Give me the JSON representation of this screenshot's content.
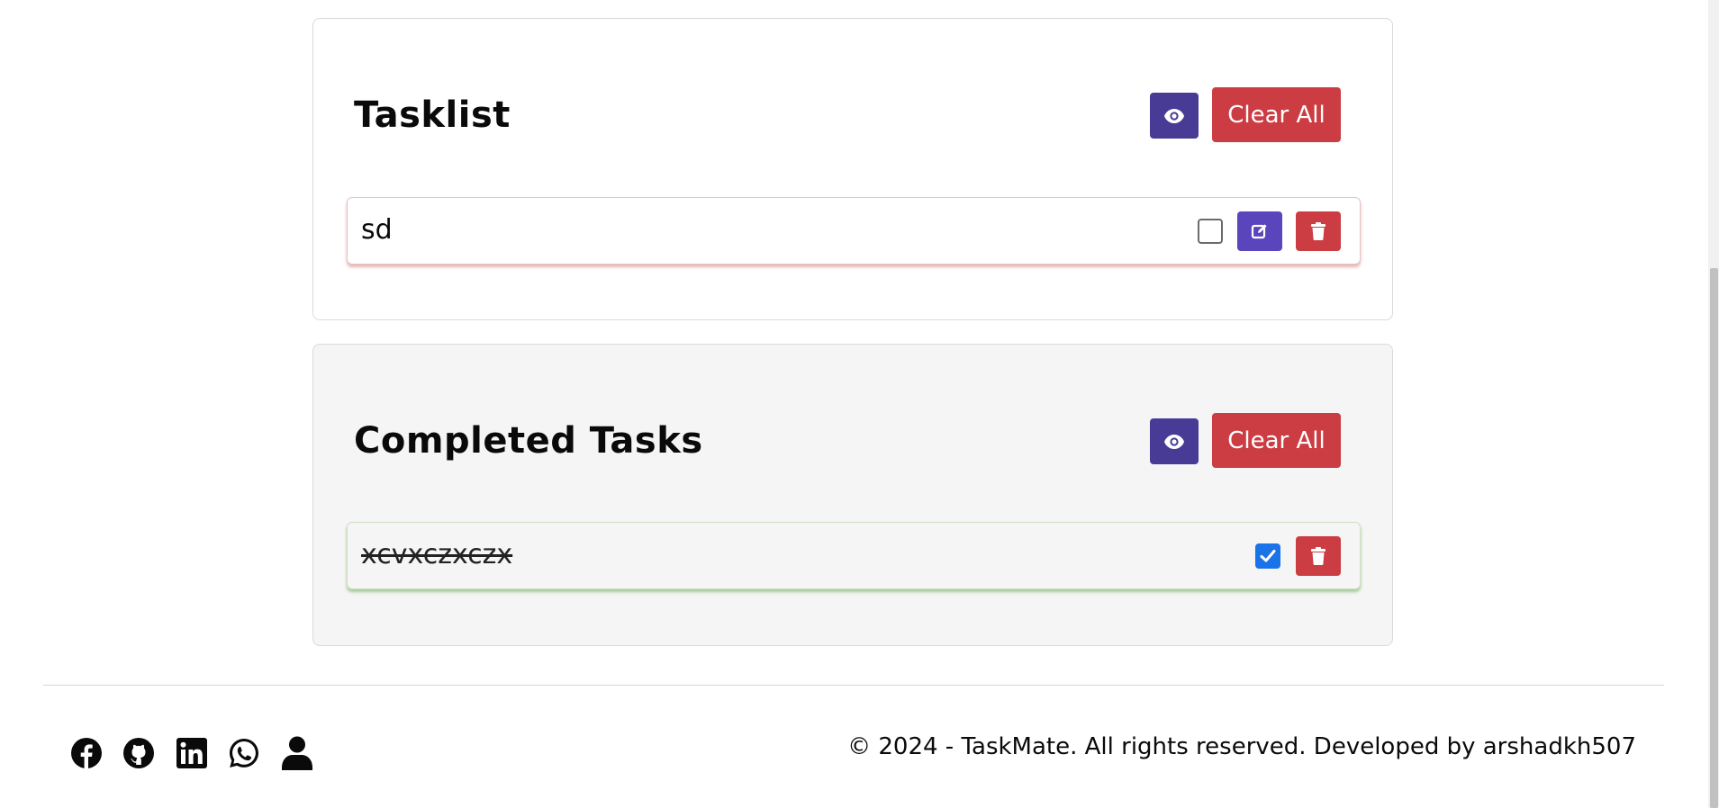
{
  "tasklist": {
    "title": "Tasklist",
    "clear_all_label": "Clear All",
    "items": [
      {
        "text": "sd",
        "completed": false
      }
    ]
  },
  "completed_tasks": {
    "title": "Completed Tasks",
    "clear_all_label": "Clear All",
    "items": [
      {
        "text": "xcvxczxczx",
        "completed": true
      }
    ]
  },
  "footer": {
    "copyright": "© 2024 - TaskMate. All rights reserved. Developed by arshadkh507",
    "social_icons": [
      "facebook-icon",
      "github-icon",
      "linkedin-icon",
      "whatsapp-icon",
      "user-icon"
    ]
  },
  "colors": {
    "eye_button": "#483b96",
    "edit_button": "#5b45bd",
    "danger_button": "#cc3d43",
    "checkbox_checked": "#1a73e8",
    "completed_card_bg": "#f5f5f5"
  }
}
